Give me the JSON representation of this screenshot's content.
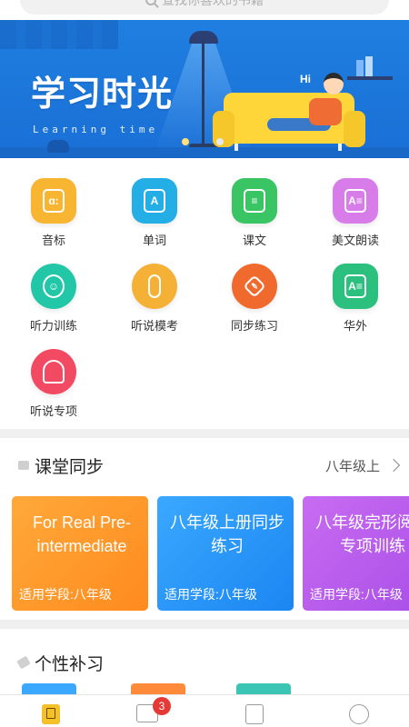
{
  "search": {
    "placeholder": "查找你喜欢的书籍"
  },
  "banner": {
    "title": "学习时光",
    "subtitle": "Learning time",
    "bubble": "Hi"
  },
  "features": [
    {
      "label": "音标",
      "icon": "phonetic-icon",
      "glyph": "ɑ:",
      "color": "#f7b531"
    },
    {
      "label": "单词",
      "icon": "word-icon",
      "glyph": "A",
      "color": "#23aee6"
    },
    {
      "label": "课文",
      "icon": "text-icon",
      "glyph": "≡",
      "color": "#3ac565"
    },
    {
      "label": "美文朗读",
      "icon": "reading-icon",
      "glyph": "A≡",
      "color": "#d77ce8"
    },
    {
      "label": "听力训练",
      "icon": "listening-icon",
      "glyph": "☺",
      "color": "#21c7a6"
    },
    {
      "label": "听说模考",
      "icon": "mic-icon",
      "glyph": "🎙",
      "color": "#f5b135"
    },
    {
      "label": "同步练习",
      "icon": "pen-icon",
      "glyph": "✒",
      "color": "#f06a2e"
    },
    {
      "label": "华外",
      "icon": "scnufl-icon",
      "glyph": "A≡",
      "color": "#2cc07e"
    },
    {
      "label": "听说专项",
      "icon": "headphone-icon",
      "glyph": "🎧",
      "color": "#f24a62"
    }
  ],
  "classroom": {
    "title": "课堂同步",
    "grade_selector": "八年级上",
    "cards": [
      {
        "title": "For Real Pre-intermediate",
        "footer": "适用学段:八年级",
        "color_from": "#ffa93a",
        "color_to": "#ff8a1e"
      },
      {
        "title": "八年级上册同步练习",
        "footer": "适用学段:八年级",
        "color_from": "#3aa8ff",
        "color_to": "#1b86f2"
      },
      {
        "title": "八年级完形阅读专项训练",
        "footer": "适用学段:八年级",
        "color_from": "#c86cf2",
        "color_to": "#a84ee6"
      }
    ]
  },
  "personal": {
    "title": "个性补习"
  },
  "bottom_nav": {
    "items": [
      {
        "name": "bookmark-icon"
      },
      {
        "name": "book-icon"
      },
      {
        "name": "score-icon"
      },
      {
        "name": "profile-icon"
      }
    ],
    "badge": "3"
  }
}
